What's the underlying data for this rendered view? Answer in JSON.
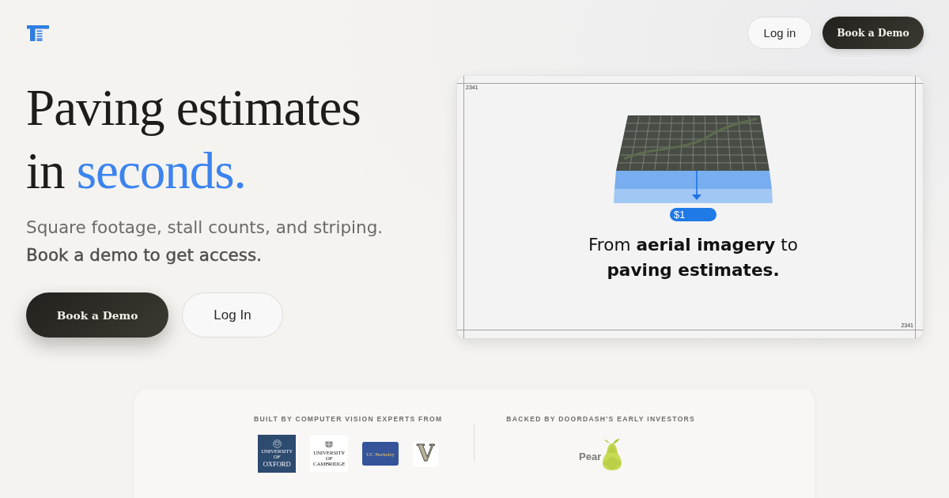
{
  "header": {
    "buttons": [
      {
        "label": "Log in",
        "kind": "secondary"
      },
      {
        "label": "Book a Demo",
        "kind": "primary"
      }
    ]
  },
  "hero": {
    "headline": [
      [
        {
          "text": "Paving estimates",
          "accent": false
        }
      ],
      [
        {
          "text": "in",
          "accent": false
        },
        {
          "text": "seconds.",
          "accent": true
        }
      ]
    ],
    "subtitle": "Square footage, stall counts, and striping.",
    "note": "Book a demo to get access.",
    "buttons": [
      {
        "label": "Book a Demo",
        "kind": "primary"
      },
      {
        "label": "Log In",
        "kind": "secondary"
      }
    ]
  },
  "preview": {
    "corner_labels": [
      "2341",
      "2341"
    ],
    "price_tag": "$1",
    "caption": "From **aerial imagery** to **paving estimates.**"
  },
  "backers": [
    {
      "heading": "BUILT BY COMPUTER VISION EXPERTS FROM",
      "logos": [
        {
          "kind": "crest-dark",
          "lines": [
            "UNIVERSITY OF",
            "OXFORD"
          ]
        },
        {
          "kind": "crest-light",
          "lines": [
            "UNIVERSITY OF",
            "CAMBRIDGE"
          ]
        },
        {
          "kind": "wordmark",
          "text": "UC Berkeley"
        },
        {
          "kind": "letter",
          "text": "V"
        }
      ]
    },
    {
      "heading": "BACKED BY DOORDASH'S EARLY INVESTORS",
      "logos": [
        {
          "kind": "fruit",
          "text": "Pear"
        }
      ]
    }
  ]
}
